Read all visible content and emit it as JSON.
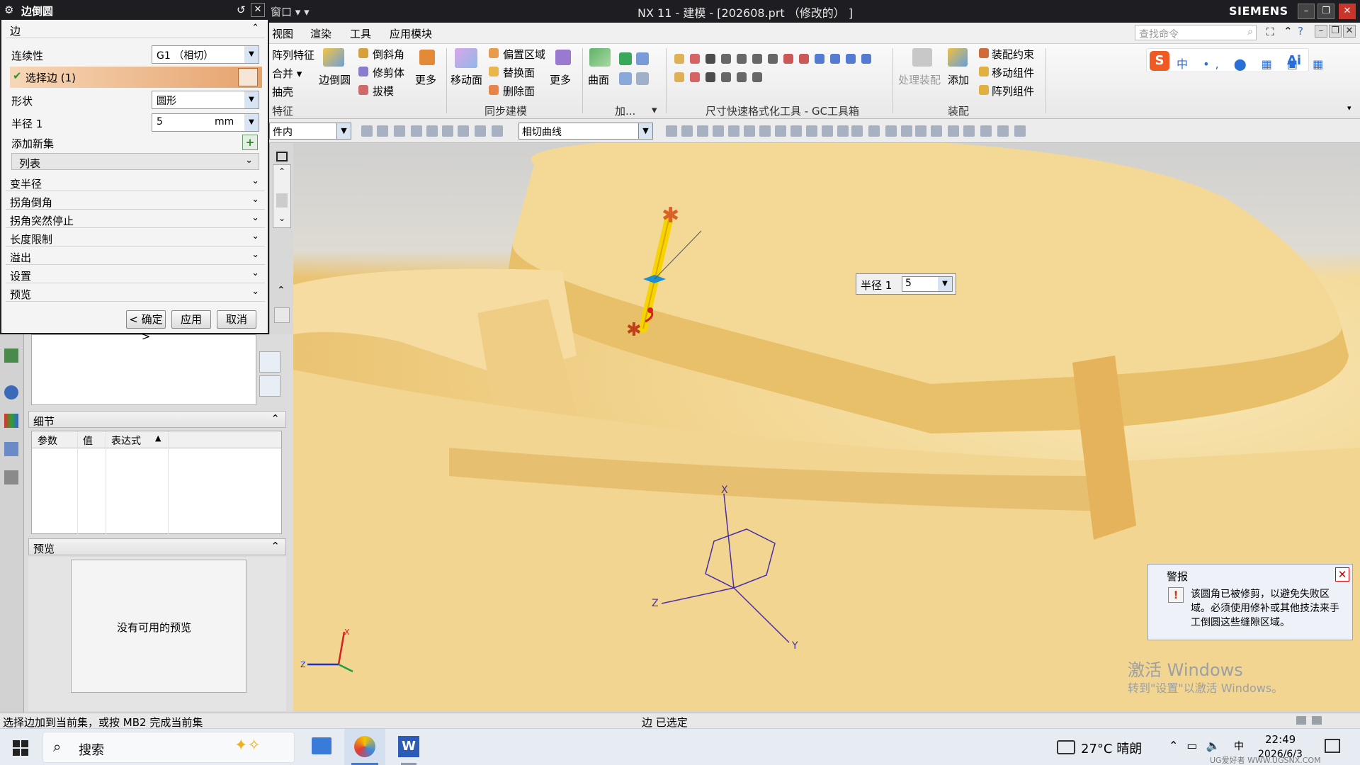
{
  "window": {
    "title": "NX 11 - 建模 - [202608.prt （修改的） ]",
    "brand": "SIEMENS",
    "quick_access": "窗口 ▾ ▾"
  },
  "menu": {
    "items": [
      "视图",
      "渲染",
      "工具",
      "应用模块"
    ],
    "search_placeholder": "查找命令"
  },
  "ribbon": {
    "feature": {
      "btn_array": "阵列特征",
      "btn_unite": "合并 ▾",
      "btn_shell": "抽壳",
      "btn_edge_blend": "边倒圆",
      "btn_chamfer": "倒斜角",
      "btn_trim_body": "修剪体",
      "btn_draft": "拔模",
      "btn_more": "更多",
      "group": "特征"
    },
    "sync": {
      "btn_move_face": "移动面",
      "btn_offset_region": "偏置区域",
      "btn_replace_face": "替换面",
      "btn_delete_face": "删除面",
      "btn_more": "更多",
      "group": "同步建模"
    },
    "surface": {
      "btn_surface": "曲面",
      "group_add": "加...",
      "more": "▾"
    },
    "gc": {
      "group": "尺寸快速格式化工具 - GC工具箱"
    },
    "assembly": {
      "btn_process": "处理装配",
      "btn_add": "添加",
      "btn_constraint": "装配约束",
      "btn_move_comp": "移动组件",
      "btn_array_comp": "阵列组件",
      "group": "装配"
    }
  },
  "toolbar2": {
    "filter_combo": "件内",
    "curve_rule": "相切曲线"
  },
  "dialog": {
    "title": "边倒圆",
    "section_edge": "边",
    "continuity_label": "连续性",
    "continuity_value": "G1 （相切）",
    "select_edge": "选择边 (1)",
    "shape_label": "形状",
    "shape_value": "圆形",
    "radius_label": "半径 1",
    "radius_value": "5",
    "radius_unit": "mm",
    "add_set": "添加新集",
    "list_label": "列表",
    "collapsed_sections": [
      "变半径",
      "拐角倒角",
      "拐角突然停止",
      "长度限制",
      "溢出",
      "设置",
      "预览"
    ],
    "btn_ok": "< 确定 >",
    "btn_apply": "应用",
    "btn_cancel": "取消"
  },
  "detail_panel": {
    "header": "细节",
    "columns": [
      "参数",
      "值",
      "表达式"
    ]
  },
  "preview_panel": {
    "header": "预览",
    "empty_text": "没有可用的预览"
  },
  "viewport": {
    "radius_callout_label": "半径 1",
    "radius_callout_value": "5",
    "axis_x": "X",
    "axis_y": "Y",
    "axis_z": "Z"
  },
  "alert": {
    "title": "警报",
    "message": "该圆角已被修剪，以避免失败区域。必须使用修补或其他技法来手工倒圆这些缝隙区域。"
  },
  "watermark": {
    "line1": "激活 Windows",
    "line2": "转到\"设置\"以激活 Windows。"
  },
  "status": {
    "left": "选择边加到当前集，或按 MB2 完成当前集",
    "center": "边 已选定"
  },
  "taskbar": {
    "search_label": "搜索",
    "weather": "27°C  晴朗",
    "time": "22:49",
    "date": "2026/6/3",
    "corner_watermark": "UG爱好者 WWW.UGSNX.COM"
  },
  "colors": {
    "titlebar": "#1e1e22",
    "edge_highlight": "#f5d400",
    "part_color": "#f2d48e",
    "accent_orange": "#e08a3a"
  }
}
